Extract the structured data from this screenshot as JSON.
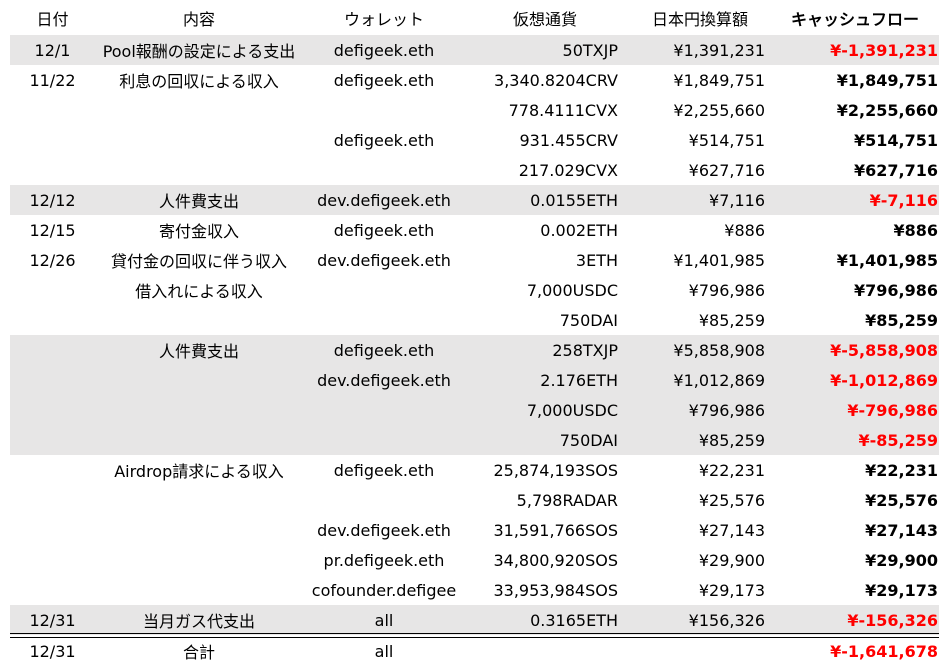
{
  "headers": {
    "date": "日付",
    "desc": "内容",
    "wallet": "ウォレット",
    "amount": "仮想通貨",
    "jpy": "日本円換算額",
    "cashflow": "キャッシュフロー"
  },
  "rows": [
    {
      "date": "12/1",
      "desc": "Pool報酬の設定による支出",
      "wallet": "defigeek.eth",
      "amount": "50TXJP",
      "jpy": "¥1,391,231",
      "cashflow": "¥-1,391,231",
      "negative": true,
      "shaded": true
    },
    {
      "date": "11/22",
      "desc": "利息の回収による収入",
      "wallet": "defigeek.eth",
      "amount": "3,340.8204CRV",
      "jpy": "¥1,849,751",
      "cashflow": "¥1,849,751",
      "negative": false,
      "shaded": false
    },
    {
      "date": "",
      "desc": "",
      "wallet": "",
      "amount": "778.4111CVX",
      "jpy": "¥2,255,660",
      "cashflow": "¥2,255,660",
      "negative": false,
      "shaded": false
    },
    {
      "date": "",
      "desc": "",
      "wallet": "defigeek.eth",
      "amount": "931.455CRV",
      "jpy": "¥514,751",
      "cashflow": "¥514,751",
      "negative": false,
      "shaded": false
    },
    {
      "date": "",
      "desc": "",
      "wallet": "",
      "amount": "217.029CVX",
      "jpy": "¥627,716",
      "cashflow": "¥627,716",
      "negative": false,
      "shaded": false
    },
    {
      "date": "12/12",
      "desc": "人件費支出",
      "wallet": "dev.defigeek.eth",
      "amount": "0.0155ETH",
      "jpy": "¥7,116",
      "cashflow": "¥-7,116",
      "negative": true,
      "shaded": true
    },
    {
      "date": "12/15",
      "desc": "寄付金収入",
      "wallet": "defigeek.eth",
      "amount": "0.002ETH",
      "jpy": "¥886",
      "cashflow": "¥886",
      "negative": false,
      "shaded": false
    },
    {
      "date": "12/26",
      "desc": "貸付金の回収に伴う収入",
      "wallet": "dev.defigeek.eth",
      "amount": "3ETH",
      "jpy": "¥1,401,985",
      "cashflow": "¥1,401,985",
      "negative": false,
      "shaded": false
    },
    {
      "date": "",
      "desc": "借入れによる収入",
      "wallet": "",
      "amount": "7,000USDC",
      "jpy": "¥796,986",
      "cashflow": "¥796,986",
      "negative": false,
      "shaded": false
    },
    {
      "date": "",
      "desc": "",
      "wallet": "",
      "amount": "750DAI",
      "jpy": "¥85,259",
      "cashflow": "¥85,259",
      "negative": false,
      "shaded": false
    },
    {
      "date": "",
      "desc": "人件費支出",
      "wallet": "defigeek.eth",
      "amount": "258TXJP",
      "jpy": "¥5,858,908",
      "cashflow": "¥-5,858,908",
      "negative": true,
      "shaded": true
    },
    {
      "date": "",
      "desc": "",
      "wallet": "dev.defigeek.eth",
      "amount": "2.176ETH",
      "jpy": "¥1,012,869",
      "cashflow": "¥-1,012,869",
      "negative": true,
      "shaded": true
    },
    {
      "date": "",
      "desc": "",
      "wallet": "",
      "amount": "7,000USDC",
      "jpy": "¥796,986",
      "cashflow": "¥-796,986",
      "negative": true,
      "shaded": true
    },
    {
      "date": "",
      "desc": "",
      "wallet": "",
      "amount": "750DAI",
      "jpy": "¥85,259",
      "cashflow": "¥-85,259",
      "negative": true,
      "shaded": true
    },
    {
      "date": "",
      "desc": "Airdrop請求による収入",
      "wallet": "defigeek.eth",
      "amount": "25,874,193SOS",
      "jpy": "¥22,231",
      "cashflow": "¥22,231",
      "negative": false,
      "shaded": false
    },
    {
      "date": "",
      "desc": "",
      "wallet": "",
      "amount": "5,798RADAR",
      "jpy": "¥25,576",
      "cashflow": "¥25,576",
      "negative": false,
      "shaded": false
    },
    {
      "date": "",
      "desc": "",
      "wallet": "dev.defigeek.eth",
      "amount": "31,591,766SOS",
      "jpy": "¥27,143",
      "cashflow": "¥27,143",
      "negative": false,
      "shaded": false
    },
    {
      "date": "",
      "desc": "",
      "wallet": "pr.defigeek.eth",
      "amount": "34,800,920SOS",
      "jpy": "¥29,900",
      "cashflow": "¥29,900",
      "negative": false,
      "shaded": false
    },
    {
      "date": "",
      "desc": "",
      "wallet": "cofounder.defigee",
      "amount": "33,953,984SOS",
      "jpy": "¥29,173",
      "cashflow": "¥29,173",
      "negative": false,
      "shaded": false
    },
    {
      "date": "12/31",
      "desc": "当月ガス代支出",
      "wallet": "all",
      "amount": "0.3165ETH",
      "jpy": "¥156,326",
      "cashflow": "¥-156,326",
      "negative": true,
      "shaded": true
    }
  ],
  "total": {
    "date": "12/31",
    "desc": "合計",
    "wallet": "all",
    "amount": "",
    "jpy": "",
    "cashflow": "¥-1,641,678",
    "negative": true
  },
  "colors": {
    "negative": "#ff0000",
    "shade": "#e7e6e6",
    "text": "#000000"
  }
}
